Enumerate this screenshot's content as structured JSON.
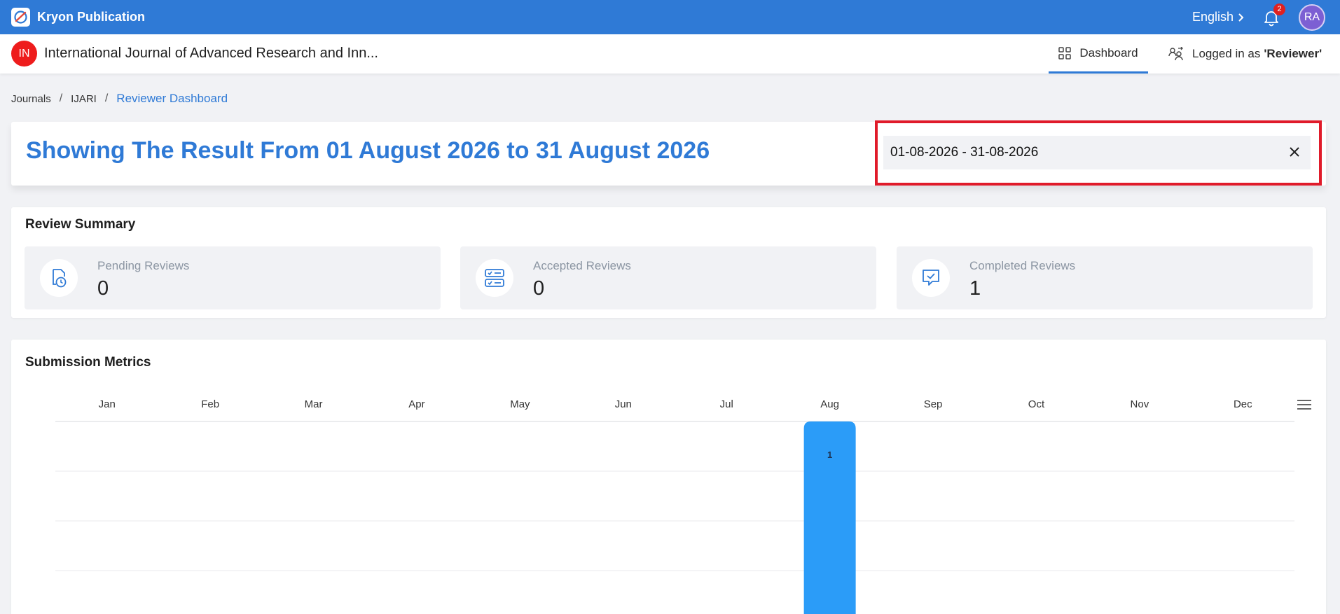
{
  "app": {
    "name": "Kryon Publication"
  },
  "topbar": {
    "language": "English",
    "notifications_count": "2",
    "avatar_initials": "RA"
  },
  "journal": {
    "badge": "IN",
    "title": "International Journal of Advanced Research and Inn..."
  },
  "nav": {
    "dashboard": "Dashboard",
    "logged_in_prefix": "Logged in as",
    "role": "'Reviewer'"
  },
  "breadcrumb": [
    "Journals",
    "IJARI",
    "Reviewer Dashboard"
  ],
  "range": {
    "title": "Showing The Result From 01 August 2026 to 31 August 2026",
    "date_value": "01-08-2026 - 31-08-2026"
  },
  "summary": {
    "title": "Review Summary",
    "cards": [
      {
        "label": "Pending Reviews",
        "value": "0",
        "icon": "file-clock-icon"
      },
      {
        "label": "Accepted Reviews",
        "value": "0",
        "icon": "server-list-icon"
      },
      {
        "label": "Completed Reviews",
        "value": "1",
        "icon": "message-check-icon"
      }
    ]
  },
  "metrics": {
    "title": "Submission Metrics"
  },
  "colors": {
    "primary": "#2f7ad6",
    "bar": "#2b9cf8",
    "highlight": "#e01b2a"
  },
  "chart_data": {
    "type": "bar",
    "orientation": "vertical",
    "x_axis_position": "top",
    "categories": [
      "Jan",
      "Feb",
      "Mar",
      "Apr",
      "May",
      "Jun",
      "Jul",
      "Aug",
      "Sep",
      "Oct",
      "Nov",
      "Dec"
    ],
    "values": [
      0,
      0,
      0,
      0,
      0,
      0,
      0,
      1,
      0,
      0,
      0,
      0
    ],
    "data_labels": true,
    "grid": true
  }
}
